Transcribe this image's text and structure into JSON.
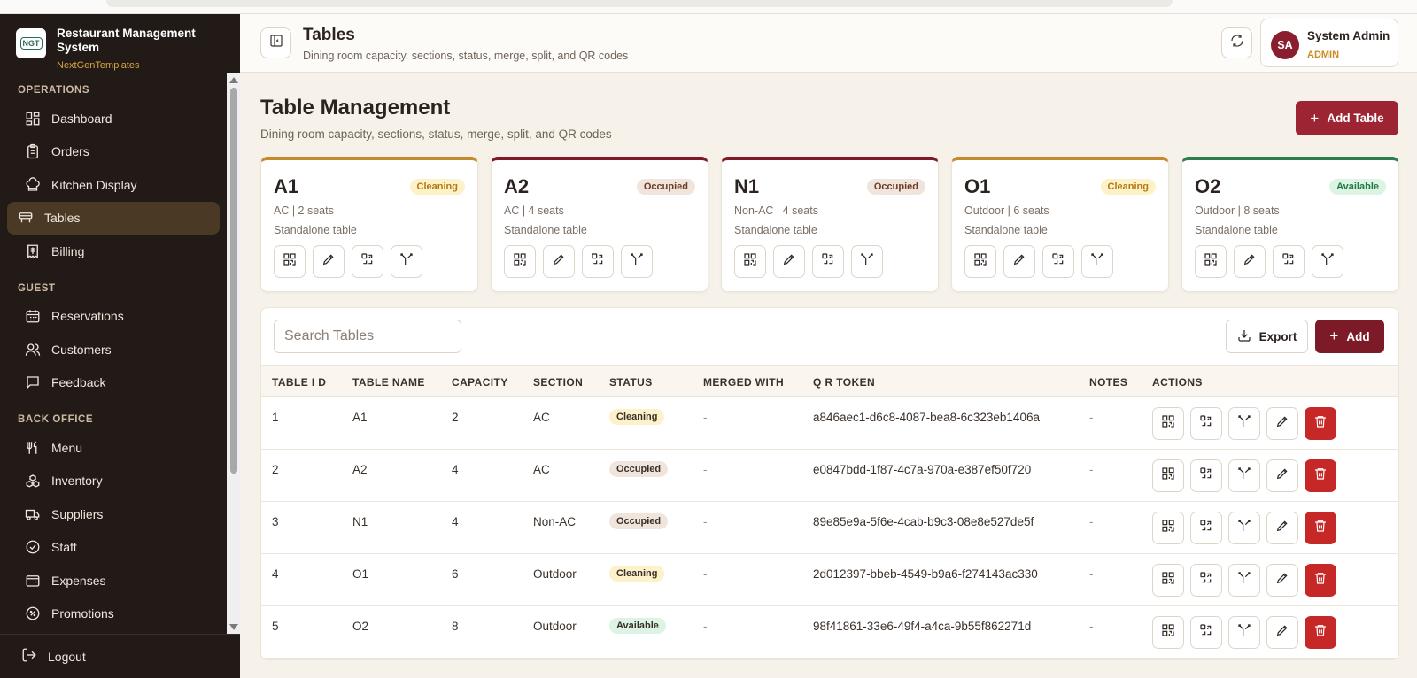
{
  "brand": {
    "title": "Restaurant Management System",
    "subtitle": "NextGenTemplates",
    "logo_text": "NGT"
  },
  "nav": {
    "sections": [
      {
        "label": "OPERATIONS",
        "items": [
          {
            "label": "Dashboard",
            "icon": "dashboard-icon"
          },
          {
            "label": "Orders",
            "icon": "clipboard-icon"
          },
          {
            "label": "Kitchen Display",
            "icon": "chef-hat-icon"
          },
          {
            "label": "Tables",
            "icon": "table-icon",
            "active": true
          },
          {
            "label": "Billing",
            "icon": "receipt-icon"
          }
        ]
      },
      {
        "label": "GUEST",
        "items": [
          {
            "label": "Reservations",
            "icon": "calendar-icon"
          },
          {
            "label": "Customers",
            "icon": "users-icon"
          },
          {
            "label": "Feedback",
            "icon": "message-icon"
          }
        ]
      },
      {
        "label": "BACK OFFICE",
        "items": [
          {
            "label": "Menu",
            "icon": "utensils-icon"
          },
          {
            "label": "Inventory",
            "icon": "boxes-icon"
          },
          {
            "label": "Suppliers",
            "icon": "truck-icon"
          },
          {
            "label": "Staff",
            "icon": "badge-check-icon"
          },
          {
            "label": "Expenses",
            "icon": "wallet-icon"
          },
          {
            "label": "Promotions",
            "icon": "percent-icon"
          }
        ]
      }
    ],
    "logout_label": "Logout"
  },
  "header": {
    "title": "Tables",
    "subtitle": "Dining room capacity, sections, status, merge, split, and QR codes",
    "user_name": "System Admin",
    "user_role": "ADMIN",
    "user_initials": "SA"
  },
  "main": {
    "title": "Table Management",
    "subtitle": "Dining room capacity, sections, status, merge, split, and QR codes",
    "add_table_label": "Add Table"
  },
  "cards": [
    {
      "id": "A1",
      "status": "Cleaning",
      "meta": "AC | 2 seats",
      "note": "Standalone table",
      "accent": "#c48a2c"
    },
    {
      "id": "A2",
      "status": "Occupied",
      "meta": "AC | 4 seats",
      "note": "Standalone table",
      "accent": "#7d1a28"
    },
    {
      "id": "N1",
      "status": "Occupied",
      "meta": "Non-AC | 4 seats",
      "note": "Standalone table",
      "accent": "#7d1a28"
    },
    {
      "id": "O1",
      "status": "Cleaning",
      "meta": "Outdoor | 6 seats",
      "note": "Standalone table",
      "accent": "#c48a2c"
    },
    {
      "id": "O2",
      "status": "Available",
      "meta": "Outdoor | 8 seats",
      "note": "Standalone table",
      "accent": "#2e7d4f"
    }
  ],
  "table": {
    "search_placeholder": "Search Tables",
    "export_label": "Export",
    "add_label": "Add",
    "columns": [
      "TABLE I D",
      "TABLE NAME",
      "CAPACITY",
      "SECTION",
      "STATUS",
      "MERGED WITH",
      "Q R TOKEN",
      "NOTES",
      "ACTIONS"
    ],
    "rows": [
      {
        "id": "1",
        "name": "A1",
        "capacity": "2",
        "section": "AC",
        "status": "Cleaning",
        "merged": "-",
        "token": "a846aec1-d6c8-4087-bea8-6c323eb1406a",
        "notes": "-"
      },
      {
        "id": "2",
        "name": "A2",
        "capacity": "4",
        "section": "AC",
        "status": "Occupied",
        "merged": "-",
        "token": "e0847bdd-1f87-4c7a-970a-e387ef50f720",
        "notes": "-"
      },
      {
        "id": "3",
        "name": "N1",
        "capacity": "4",
        "section": "Non-AC",
        "status": "Occupied",
        "merged": "-",
        "token": "89e85e9a-5f6e-4cab-b9c3-08e8e527de5f",
        "notes": "-"
      },
      {
        "id": "4",
        "name": "O1",
        "capacity": "6",
        "section": "Outdoor",
        "status": "Cleaning",
        "merged": "-",
        "token": "2d012397-bbeb-4549-b9a6-f274143ac330",
        "notes": "-"
      },
      {
        "id": "5",
        "name": "O2",
        "capacity": "8",
        "section": "Outdoor",
        "status": "Available",
        "merged": "-",
        "token": "98f41861-33e6-49f4-a4ca-9b55f862271d",
        "notes": "-"
      }
    ]
  },
  "colors": {
    "primary": "#9c2433",
    "sidebar": "#221a16",
    "accent_gold": "#c98d22",
    "danger": "#c62828"
  }
}
